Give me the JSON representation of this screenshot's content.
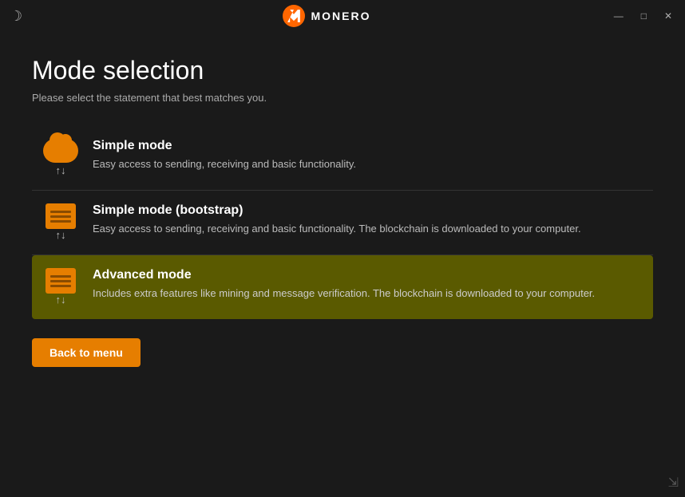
{
  "titlebar": {
    "title": "MONERO",
    "moon_icon": "☽",
    "minimize_label": "—",
    "maximize_label": "□",
    "close_label": "✕"
  },
  "page": {
    "title": "Mode selection",
    "subtitle": "Please select the statement that best matches you."
  },
  "modes": [
    {
      "id": "simple",
      "name": "Simple mode",
      "description": "Easy access to sending, receiving and basic functionality.",
      "icon_type": "cloud",
      "active": false
    },
    {
      "id": "simple-bootstrap",
      "name": "Simple mode (bootstrap)",
      "description": "Easy access to sending, receiving and basic functionality. The blockchain is downloaded to your computer.",
      "icon_type": "db",
      "active": false
    },
    {
      "id": "advanced",
      "name": "Advanced mode",
      "description": "Includes extra features like mining and message verification. The blockchain is downloaded to your computer.",
      "icon_type": "db",
      "active": true
    }
  ],
  "buttons": {
    "back_to_menu": "Back to menu"
  }
}
